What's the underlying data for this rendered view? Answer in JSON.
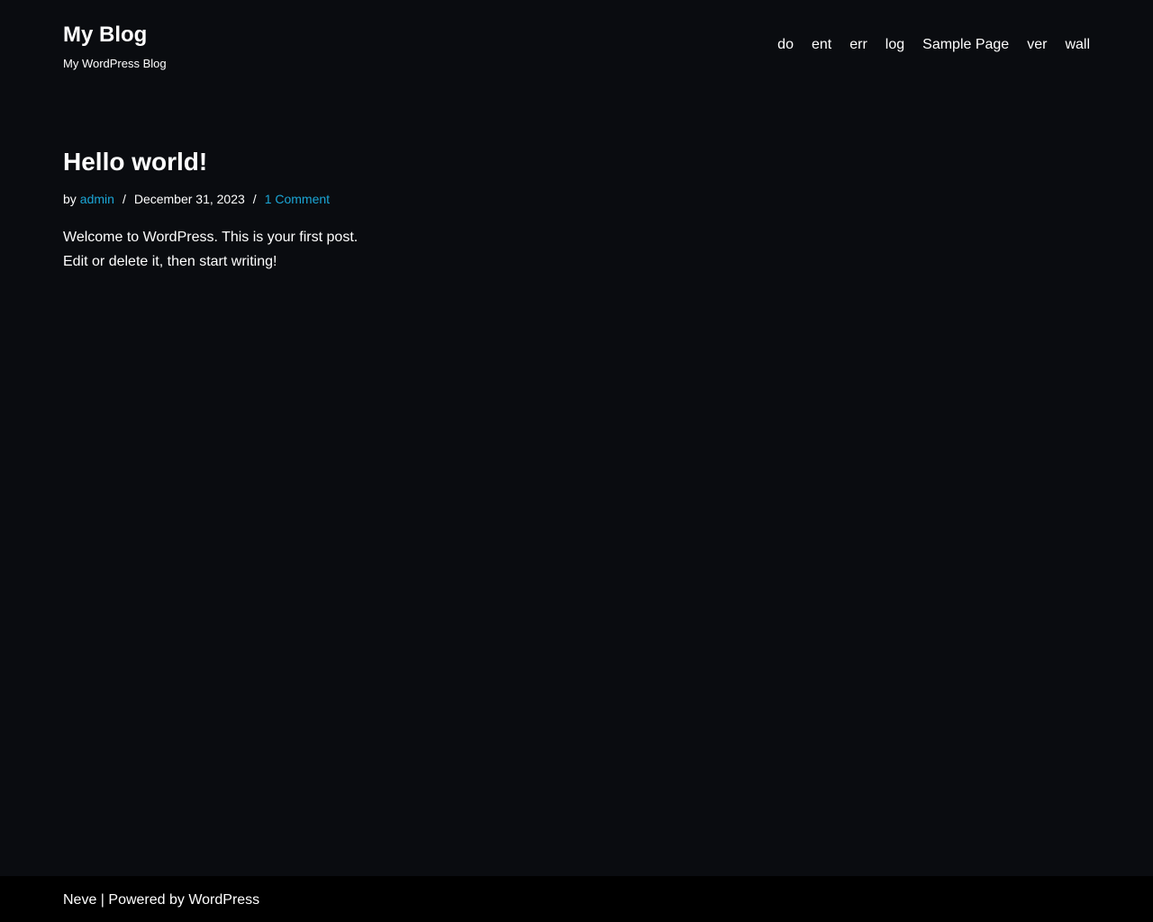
{
  "site": {
    "title": "My Blog",
    "tagline": "My WordPress Blog"
  },
  "nav": {
    "items": [
      {
        "label": "do"
      },
      {
        "label": "ent"
      },
      {
        "label": "err"
      },
      {
        "label": "log"
      },
      {
        "label": "Sample Page"
      },
      {
        "label": "ver"
      },
      {
        "label": "wall"
      }
    ]
  },
  "post": {
    "title": "Hello world!",
    "meta": {
      "by": "by",
      "author": "admin",
      "separator": "/",
      "date": "December 31, 2023",
      "comments": "1 Comment"
    },
    "excerpt": "Welcome to WordPress. This is your first post. Edit or delete it, then start writing!"
  },
  "footer": {
    "theme": "Neve",
    "divider": " | ",
    "powered_by": "Powered by WordPress"
  },
  "colors": {
    "background": "#0a0c10",
    "footer_background": "#000000",
    "link": "#1ba6d6",
    "text": "#ffffff"
  }
}
